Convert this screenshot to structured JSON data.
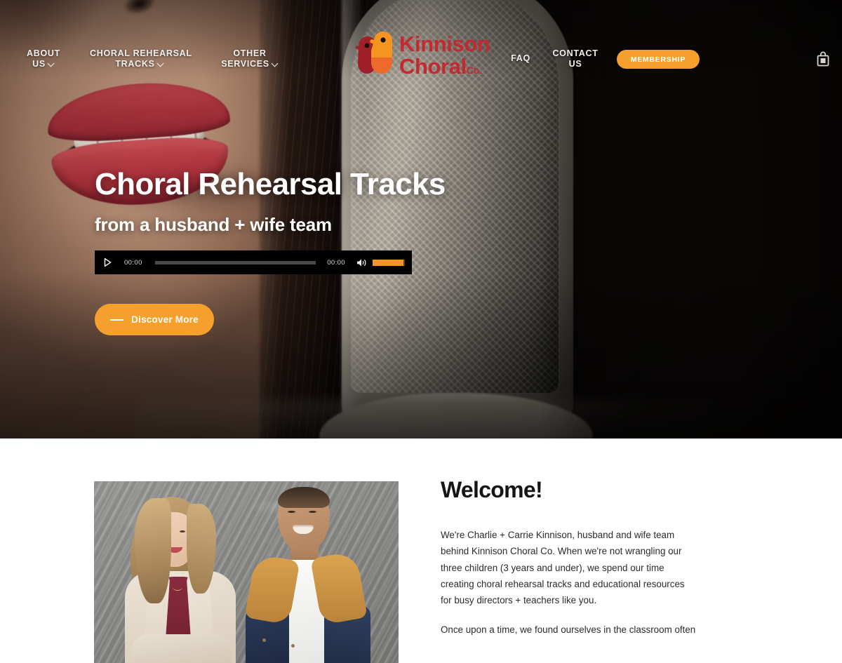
{
  "nav": {
    "items": [
      {
        "label": "ABOUT US",
        "line1": "ABOUT",
        "line2": "US",
        "has_chevron": true,
        "icon": "chevron-down-icon"
      },
      {
        "label": "CHORAL REHEARSAL TRACKS",
        "line1": "CHORAL REHEARSAL",
        "line2": "TRACKS",
        "has_chevron": true,
        "icon": "chevron-down-icon"
      },
      {
        "label": "OTHER SERVICES",
        "line1": "OTHER",
        "line2": "SERVICES",
        "has_chevron": true,
        "icon": "chevron-down-icon"
      },
      {
        "label": "FAQ",
        "line1": "FAQ",
        "line2": "",
        "has_chevron": false,
        "icon": ""
      },
      {
        "label": "CONTACT US",
        "line1": "CONTACT",
        "line2": "US",
        "has_chevron": false,
        "icon": ""
      }
    ],
    "membership_button": "MEMBERSHIP",
    "cart_icon": "shopping-bag-icon",
    "accent_color": "#f5a02d",
    "text_color": "#f2efec"
  },
  "logo": {
    "line1": "Kinnison",
    "line2": "Choral",
    "suffix": "Co.",
    "icon": "two-birds-icon",
    "brand_red": "#c3292f",
    "brand_orange": "#f5941e",
    "brand_dark_red": "#a01f28"
  },
  "hero": {
    "heading": "Choral Rehearsal Tracks",
    "subheading": "from a husband + wife team",
    "background_image": "woman-singing-into-microphone-closeup",
    "cta": {
      "label": "Discover More",
      "icon": "dash-icon",
      "color": "#f5a02d"
    },
    "player": {
      "play_icon": "play-icon",
      "current_time": "00:00",
      "duration": "00:00",
      "volume_icon": "speaker-icon",
      "progress_percent": 0,
      "volume_percent": 96,
      "bar_color": "#f5941e",
      "background": "#000000"
    }
  },
  "welcome": {
    "image": "charlie-and-carrie-kinnison-portrait",
    "heading": "Welcome!",
    "paragraphs": [
      "We're Charlie + Carrie Kinnison, husband and wife team behind Kinnison Choral Co. When we're not wrangling our three children (3 years and under), we spend our time creating choral rehearsal tracks and educational resources for busy directors + teachers like you.",
      "Once upon a time, we found ourselves in the classroom often"
    ]
  }
}
